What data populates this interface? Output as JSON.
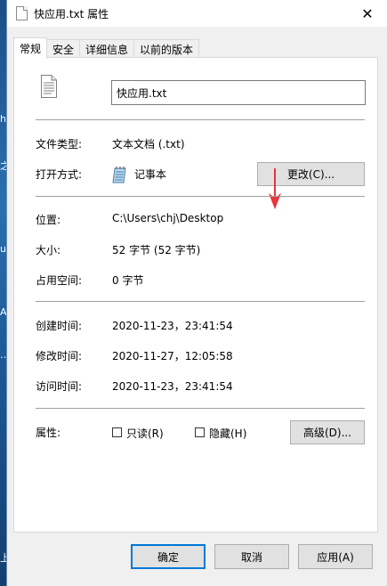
{
  "window": {
    "title": "快应用.txt 属性",
    "close_glyph": "✕"
  },
  "tabs": [
    {
      "label": "常规",
      "active": true
    },
    {
      "label": "安全",
      "active": false
    },
    {
      "label": "详细信息",
      "active": false
    },
    {
      "label": "以前的版本",
      "active": false
    }
  ],
  "general": {
    "file_name": "快应用.txt",
    "file_type_label": "文件类型:",
    "file_type_value": "文本文档 (.txt)",
    "opens_with_label": "打开方式:",
    "opens_with_value": "记事本",
    "change_button": "更改(C)...",
    "location_label": "位置:",
    "location_value": "C:\\Users\\chj\\Desktop",
    "size_label": "大小:",
    "size_value": "52 字节 (52 字节)",
    "size_on_disk_label": "占用空间:",
    "size_on_disk_value": "0 字节",
    "created_label": "创建时间:",
    "created_value": "2020-11-23，23:41:54",
    "modified_label": "修改时间:",
    "modified_value": "2020-11-27，12:05:58",
    "accessed_label": "访问时间:",
    "accessed_value": "2020-11-23，23:41:54",
    "attributes_label": "属性:",
    "readonly_label": "只读(R)",
    "readonly_checked": false,
    "hidden_label": "隐藏(H)",
    "hidden_checked": false,
    "advanced_button": "高级(D)..."
  },
  "footer": {
    "ok_button": "确定",
    "cancel_button": "取消",
    "apply_button": "应用(A)"
  },
  "desktop": {
    "glyphs": [
      "h",
      "之",
      "u",
      "A",
      "…",
      "上"
    ]
  },
  "colors": {
    "arrow": "#e8343a",
    "focus_border": "#0078d7",
    "desktop": "#1f5f9b"
  },
  "icons": {
    "title": "text-file-icon",
    "file": "text-document-icon",
    "app": "notepad-icon",
    "close": "close-icon",
    "annotation": "red-arrow-down"
  }
}
